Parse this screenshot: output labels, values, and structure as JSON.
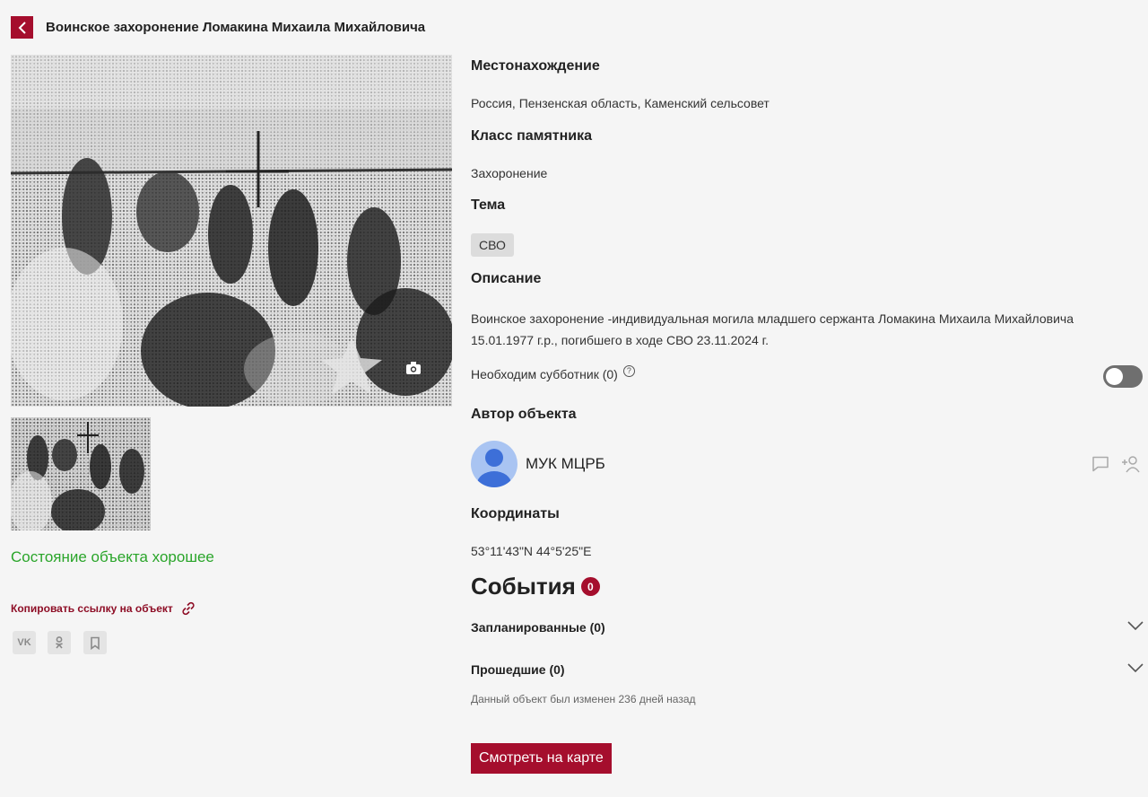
{
  "header": {
    "title": "Воинское захоронение Ломакина Михаила Михайловича"
  },
  "photos": {
    "main_alt": "grave-photo",
    "thumbnail_alt": "grave-photo-thumbnail"
  },
  "left": {
    "condition": "Состояние объекта хорошее",
    "copy_link": "Копировать ссылку на объект",
    "share": {
      "vk": "VK",
      "ok": "ok-icon",
      "bookmark": "bookmark-icon"
    }
  },
  "details": {
    "location_heading": "Местонахождение",
    "location": "Россия, Пензенская область, Каменский сельсовет",
    "class_heading": "Класс памятника",
    "class": "Захоронение",
    "theme_heading": "Тема",
    "theme_tag": "СВО",
    "description_heading": "Описание",
    "description": "Воинское захоронение -индивидуальная могила младшего сержанта Ломакина Михаила Михайловича 15.01.1977 г.р., погибшего в ходе СВО 23.11.2024 г.",
    "cleanup_label": "Необходим субботник (0)",
    "cleanup_help": "?",
    "cleanup_toggle_on": false,
    "author_heading": "Автор объекта",
    "author_name": "МУК МЦРБ",
    "coords_heading": "Координаты",
    "coords": "53°11'43\"N 44°5'25\"E"
  },
  "events": {
    "title": "События",
    "badge": "0",
    "planned": "Запланированные (0)",
    "past": "Прошедшие (0)",
    "changed_note": "Данный объект был изменен 236 дней назад"
  },
  "actions": {
    "map_button": "Смотреть на карте"
  },
  "colors": {
    "brand": "#a50e2d",
    "condition_good": "#2aa52a",
    "avatar_bg": "#a9c4f2",
    "avatar_fg": "#3d6fd8"
  }
}
